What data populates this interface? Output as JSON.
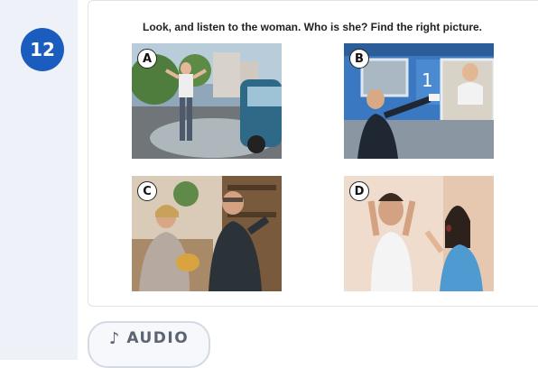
{
  "question": {
    "number": "12",
    "instruction": "Look, and listen to the woman. Who is she? Find the right picture."
  },
  "pictures": [
    {
      "letter": "A",
      "scene": "woman-splashed-by-car"
    },
    {
      "letter": "B",
      "scene": "man-passing-ticket-to-woman-on-train"
    },
    {
      "letter": "C",
      "scene": "woman-spilling-tea-on-man"
    },
    {
      "letter": "D",
      "scene": "woman-shouting-at-man"
    }
  ],
  "audio_button": {
    "icon": "music-note-icon",
    "label": "AUDIO"
  },
  "colors": {
    "badge": "#1a5dbf",
    "rail": "#eef2f8",
    "button_text": "#5b6472"
  }
}
